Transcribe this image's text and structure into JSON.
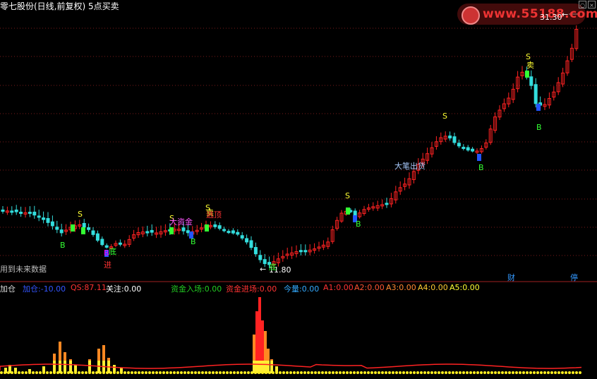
{
  "title": "零七股份(日线,前复权) 5点买卖",
  "watermark": "www.55188.com",
  "price_high": "31.30",
  "price_low": "11.80",
  "future_note": "用到未来数据",
  "badges": {
    "cai": "财",
    "ting": "停"
  },
  "signals": {
    "s": "S",
    "b": "B",
    "mai": "卖",
    "di": "底",
    "jin": "进",
    "big_money": "大资金",
    "escape": "逃顶",
    "big_out": "大笔出货"
  },
  "indicator": {
    "name": "加仓",
    "items": [
      {
        "label": "加仓:",
        "value": "-10.00",
        "color": "#3355ff"
      },
      {
        "label": "QS:",
        "value": "87.11",
        "color": "#ff3333"
      },
      {
        "label": "关注:",
        "value": "0.00",
        "color": "#ffffff"
      },
      {
        "label": "资金入场:",
        "value": "0.00",
        "color": "#22cc22"
      },
      {
        "label": "资金进场:",
        "value": "0.00",
        "color": "#ff3333"
      },
      {
        "label": "今量:",
        "value": "0.00",
        "color": "#33aaff"
      },
      {
        "label": "A1:",
        "value": "0.00",
        "color": "#ff3333"
      },
      {
        "label": "A2:",
        "value": "0.00",
        "color": "#ff5533"
      },
      {
        "label": "A3:",
        "value": "0.00",
        "color": "#ff8833"
      },
      {
        "label": "A4:",
        "value": "0.00",
        "color": "#ffcc33"
      },
      {
        "label": "A5:",
        "value": "0.00",
        "color": "#ffff33"
      }
    ]
  },
  "colors": {
    "up": "#ff2222",
    "down": "#33dddd",
    "grid": "#7a1a1a",
    "yellow": "#ffff33"
  }
}
